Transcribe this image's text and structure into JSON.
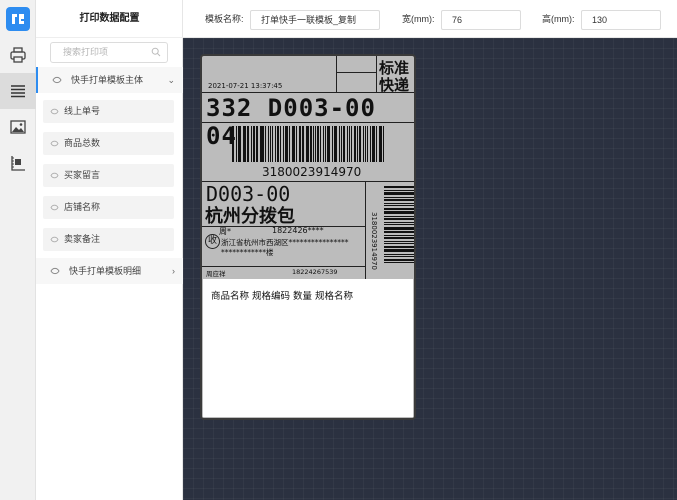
{
  "sidebar": {
    "title": "打印数据配置",
    "search_placeholder": "搜索打印项",
    "groups": [
      {
        "label": "快手打单模板主体"
      },
      {
        "label": "快手打单模板明细"
      }
    ],
    "fields": [
      {
        "label": "线上单号"
      },
      {
        "label": "商品总数"
      },
      {
        "label": "买家留言"
      },
      {
        "label": "店铺名称"
      },
      {
        "label": "卖家备注"
      }
    ]
  },
  "topbar": {
    "template_name_label": "模板名称:",
    "template_name_value": "打单快手一联模板_复制",
    "width_label": "宽(mm):",
    "width_value": "76",
    "height_label": "高(mm):",
    "height_value": "130"
  },
  "label_preview": {
    "box_text_1": "标准",
    "box_text_2": "快递",
    "datetime": "2021-07-21  13:37:45",
    "route_code": "332 D003-00 04",
    "tracking_number": "3180023914970",
    "sort_code": "D003-00",
    "hub": "杭州分拨包",
    "recv_mark": "收",
    "recv_name": "周*",
    "recv_phone": "1822426****",
    "recv_address_1": "浙江省杭州市西湖区****************",
    "recv_address_2": "************楼",
    "vertical_tracking": "3180023914970",
    "sender_name": "周应祥",
    "sender_phone": "18224267539",
    "details_header": "商品名称 规格编码 数量 规格名称"
  }
}
